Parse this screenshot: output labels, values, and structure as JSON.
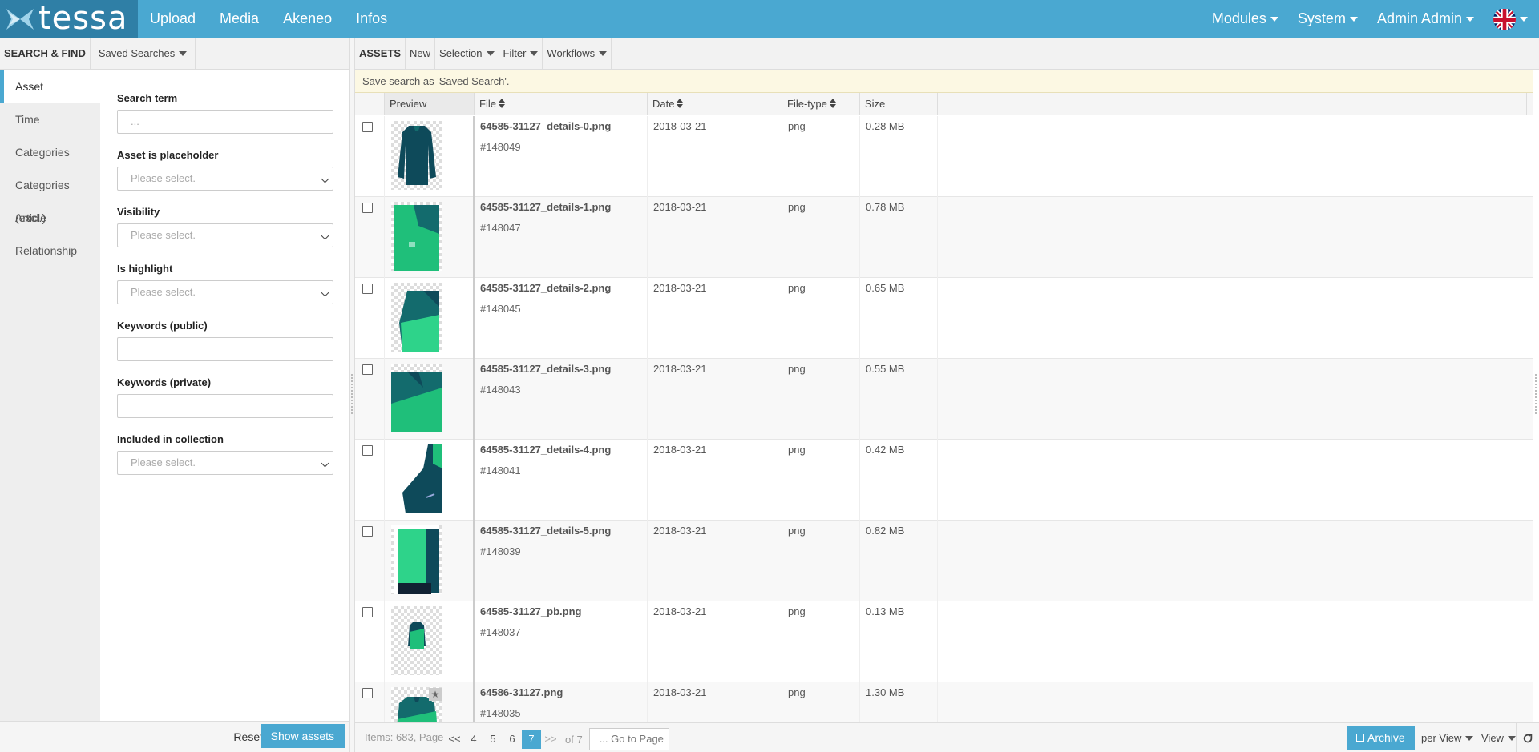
{
  "topbar": {
    "brand": "tessa",
    "nav": [
      "Upload",
      "Media",
      "Akeneo",
      "Infos"
    ],
    "right": [
      "Modules",
      "System",
      "Admin Admin"
    ]
  },
  "search": {
    "title": "SEARCH & FIND",
    "saved_searches": "Saved Searches",
    "tabs": [
      "Asset",
      "Time",
      "Categories",
      "Categories (excl.)",
      "Article",
      "Relationship"
    ],
    "active_tab": "Asset",
    "fields": [
      {
        "label": "Search term",
        "type": "text",
        "placeholder": "..."
      },
      {
        "label": "Asset is placeholder",
        "type": "select",
        "placeholder": "Please select."
      },
      {
        "label": "Visibility",
        "type": "select",
        "placeholder": "Please select."
      },
      {
        "label": "Is highlight",
        "type": "select",
        "placeholder": "Please select."
      },
      {
        "label": "Keywords (public)",
        "type": "text",
        "placeholder": ""
      },
      {
        "label": "Keywords (private)",
        "type": "text",
        "placeholder": ""
      },
      {
        "label": "Included in collection",
        "type": "select",
        "placeholder": "Please select."
      }
    ],
    "reset_label": "Reset",
    "show_label": "Show assets"
  },
  "assets": {
    "title": "ASSETS",
    "new_label": "New",
    "selection_label": "Selection",
    "filter_label": "Filter",
    "workflows_label": "Workflows",
    "notice": "Save search as 'Saved Search'.",
    "columns": [
      "Preview",
      "File",
      "Date",
      "File-type",
      "Size"
    ],
    "rows": [
      {
        "file": "64585-31127_details-0.png",
        "id": "#148049",
        "date": "2018-03-21",
        "type": "png",
        "size": "0.28 MB",
        "thumb": "full-dark"
      },
      {
        "file": "64585-31127_details-1.png",
        "id": "#148047",
        "date": "2018-03-21",
        "type": "png",
        "size": "0.78 MB",
        "thumb": "front-green"
      },
      {
        "file": "64585-31127_details-2.png",
        "id": "#148045",
        "date": "2018-03-21",
        "type": "png",
        "size": "0.65 MB",
        "thumb": "shoulder"
      },
      {
        "file": "64585-31127_details-3.png",
        "id": "#148043",
        "date": "2018-03-21",
        "type": "png",
        "size": "0.55 MB",
        "thumb": "collar"
      },
      {
        "file": "64585-31127_details-4.png",
        "id": "#148041",
        "date": "2018-03-21",
        "type": "png",
        "size": "0.42 MB",
        "thumb": "back-logo"
      },
      {
        "file": "64585-31127_details-5.png",
        "id": "#148039",
        "date": "2018-03-21",
        "type": "png",
        "size": "0.82 MB",
        "thumb": "sleeve"
      },
      {
        "file": "64585-31127_pb.png",
        "id": "#148037",
        "date": "2018-03-21",
        "type": "png",
        "size": "0.13 MB",
        "thumb": "small-full"
      },
      {
        "file": "64586-31127.png",
        "id": "#148035",
        "date": "2018-03-21",
        "type": "png",
        "size": "1.30 MB",
        "thumb": "full-green-star"
      }
    ]
  },
  "footer": {
    "items_text": "Items: 683, Page",
    "first": "<<",
    "pages": [
      "4",
      "5",
      "6",
      "7"
    ],
    "active_page": "7",
    "next": ">>",
    "of_text": "of 7",
    "goto_placeholder": "... Go to Page",
    "archive_label": "Archive",
    "per_view_label": "per View",
    "view_label": "View"
  },
  "colors": {
    "primary": "#4aa8d1",
    "brand_dark": "#2f7fa6",
    "notice_bg": "#fcf8e3"
  }
}
